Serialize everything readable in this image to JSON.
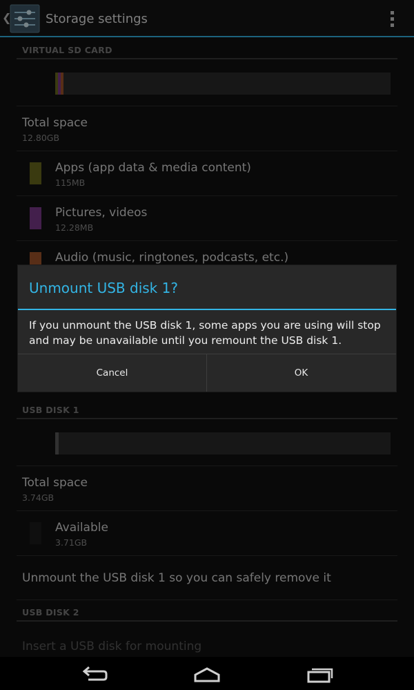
{
  "action_bar": {
    "title": "Storage settings",
    "up_icon": "back-caret-icon",
    "app_icon": "settings-sliders-icon",
    "overflow_icon": "overflow-menu-icon"
  },
  "virtual_sd": {
    "header": "VIRTUAL SD CARD",
    "usage_bar": [
      {
        "label": "Apps",
        "color": "#6b6b1e",
        "fraction": 0.009
      },
      {
        "label": "Pictures, videos",
        "color": "#7a3a8a",
        "fraction": 0.008
      },
      {
        "label": "Audio",
        "color": "#a0552a",
        "fraction": 0.008
      }
    ],
    "total": {
      "title": "Total space",
      "value": "12.80GB"
    },
    "items": [
      {
        "title": "Apps (app data & media content)",
        "value": "115MB",
        "color": "#6b6b1e"
      },
      {
        "title": "Pictures, videos",
        "value": "12.28MB",
        "color": "#7a3a8a"
      },
      {
        "title": "Audio (music, ringtones, podcasts, etc.)",
        "value": "",
        "color": "#a0552a"
      }
    ]
  },
  "usb1": {
    "header": "USB DISK 1",
    "used_fraction": 0.01,
    "total": {
      "title": "Total space",
      "value": "3.74GB"
    },
    "available": {
      "title": "Available",
      "value": "3.71GB"
    },
    "unmount": "Unmount the USB disk 1 so you can safely remove it"
  },
  "usb2": {
    "header": "USB DISK 2",
    "insert": "Insert a USB disk for mounting"
  },
  "dialog": {
    "title": "Unmount USB disk 1?",
    "message": "If you unmount the USB disk 1, some apps you are using will stop and may be unavailable until you remount the USB disk 1.",
    "cancel": "Cancel",
    "ok": "OK"
  },
  "colors": {
    "accent": "#33b5e5",
    "background": "#121212",
    "dialog": "#282828"
  },
  "nav": {
    "back_icon": "back-icon",
    "home_icon": "home-icon",
    "recents_icon": "recent-apps-icon"
  }
}
